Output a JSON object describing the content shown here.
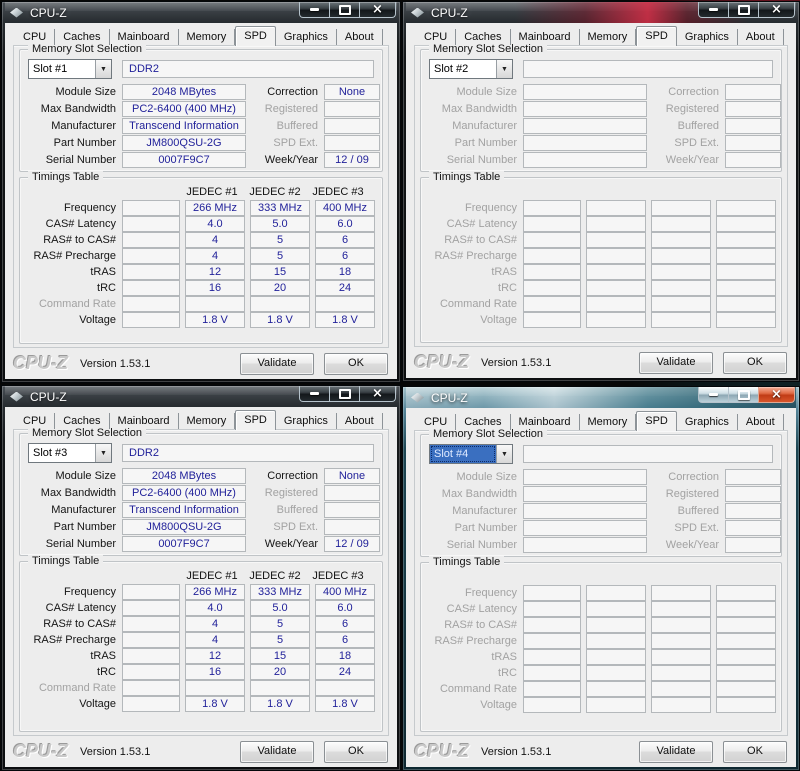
{
  "app": {
    "title": "CPU-Z",
    "tabs": [
      "CPU",
      "Caches",
      "Mainboard",
      "Memory",
      "SPD",
      "Graphics",
      "About"
    ],
    "active_tab": "SPD",
    "groups": {
      "slot_selection": "Memory Slot Selection",
      "timings": "Timings Table"
    },
    "info_labels": {
      "left": [
        "Module Size",
        "Max Bandwidth",
        "Manufacturer",
        "Part Number",
        "Serial Number"
      ],
      "right": [
        "Correction",
        "Registered",
        "Buffered",
        "SPD Ext.",
        "Week/Year"
      ]
    },
    "timing_labels": [
      "Frequency",
      "CAS# Latency",
      "RAS# to CAS#",
      "RAS# Precharge",
      "tRAS",
      "tRC",
      "Command Rate",
      "Voltage"
    ],
    "timing_headers": [
      "JEDEC #1",
      "JEDEC #2",
      "JEDEC #3"
    ],
    "logo": "CPU-Z",
    "version_label": "Version 1.53.1",
    "validate_label": "Validate",
    "ok_label": "OK",
    "icons": {
      "close": "×",
      "dropdown": "▼"
    },
    "colors": {
      "value_text": "#22229a",
      "dialog_bg": "#ededed",
      "active_close_button": "#c13c16",
      "focused_combo_bg": "#3a6fc0"
    }
  },
  "windows": [
    {
      "position": "tl",
      "titlebar": "dark",
      "active": false,
      "populated": true,
      "slot": "Slot #1",
      "slot_focused": false,
      "memory_type": "DDR2",
      "info": {
        "module_size": "2048 MBytes",
        "max_bandwidth": "PC2-6400 (400 MHz)",
        "manufacturer": "Transcend Information",
        "part_number": "JM800QSU-2G",
        "serial_number": "0007F9C7",
        "correction": "None",
        "registered": "",
        "buffered": "",
        "spd_ext": "",
        "week_year": "12 / 09"
      },
      "timings": {
        "rows": [
          [
            "266 MHz",
            "333 MHz",
            "400 MHz"
          ],
          [
            "4.0",
            "5.0",
            "6.0"
          ],
          [
            "4",
            "5",
            "6"
          ],
          [
            "4",
            "5",
            "6"
          ],
          [
            "12",
            "15",
            "18"
          ],
          [
            "16",
            "20",
            "24"
          ],
          [
            "",
            "",
            ""
          ],
          [
            "1.8 V",
            "1.8 V",
            "1.8 V"
          ]
        ]
      }
    },
    {
      "position": "tr",
      "titlebar": "red",
      "active": false,
      "populated": false,
      "slot": "Slot #2",
      "slot_focused": false,
      "memory_type": "",
      "info": {
        "module_size": "",
        "max_bandwidth": "",
        "manufacturer": "",
        "part_number": "",
        "serial_number": "",
        "correction": "",
        "registered": "",
        "buffered": "",
        "spd_ext": "",
        "week_year": ""
      },
      "timings": {
        "rows": []
      }
    },
    {
      "position": "bl",
      "titlebar": "dark",
      "active": false,
      "populated": true,
      "slot": "Slot #3",
      "slot_focused": false,
      "memory_type": "DDR2",
      "info": {
        "module_size": "2048 MBytes",
        "max_bandwidth": "PC2-6400 (400 MHz)",
        "manufacturer": "Transcend Information",
        "part_number": "JM800QSU-2G",
        "serial_number": "0007F9C7",
        "correction": "None",
        "registered": "",
        "buffered": "",
        "spd_ext": "",
        "week_year": "12 / 09"
      },
      "timings": {
        "rows": [
          [
            "266 MHz",
            "333 MHz",
            "400 MHz"
          ],
          [
            "4.0",
            "5.0",
            "6.0"
          ],
          [
            "4",
            "5",
            "6"
          ],
          [
            "4",
            "5",
            "6"
          ],
          [
            "12",
            "15",
            "18"
          ],
          [
            "16",
            "20",
            "24"
          ],
          [
            "",
            "",
            ""
          ],
          [
            "1.8 V",
            "1.8 V",
            "1.8 V"
          ]
        ]
      }
    },
    {
      "position": "br",
      "titlebar": "active",
      "active": true,
      "populated": false,
      "slot": "Slot #4",
      "slot_focused": true,
      "memory_type": "",
      "info": {
        "module_size": "",
        "max_bandwidth": "",
        "manufacturer": "",
        "part_number": "",
        "serial_number": "",
        "correction": "",
        "registered": "",
        "buffered": "",
        "spd_ext": "",
        "week_year": ""
      },
      "timings": {
        "rows": []
      }
    }
  ]
}
